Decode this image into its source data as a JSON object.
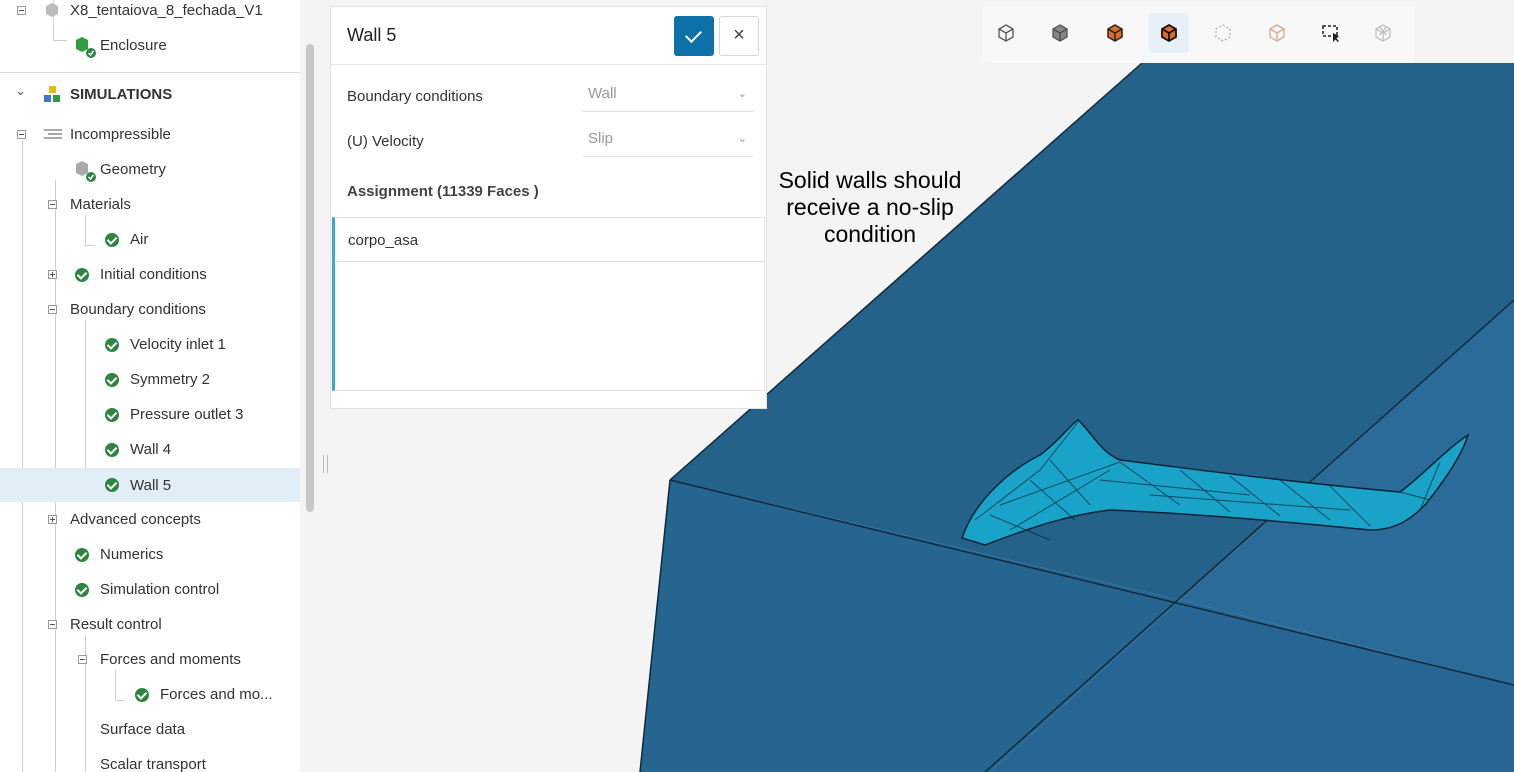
{
  "tree": {
    "top_item": "X8_tentaiova_8_fechada_V1",
    "enclosure": "Enclosure",
    "simulations_header": "SIMULATIONS",
    "incompressible": "Incompressible",
    "geometry": "Geometry",
    "materials": "Materials",
    "air": "Air",
    "initial_conditions": "Initial conditions",
    "boundary_conditions": "Boundary conditions",
    "velocity_inlet": "Velocity inlet 1",
    "symmetry": "Symmetry 2",
    "pressure_outlet": "Pressure outlet 3",
    "wall4": "Wall 4",
    "wall5": "Wall 5",
    "advanced_concepts": "Advanced concepts",
    "numerics": "Numerics",
    "simulation_control": "Simulation control",
    "result_control": "Result control",
    "forces_and_moments": "Forces and moments",
    "forces_and_mo_item": "Forces and mo...",
    "surface_data": "Surface data",
    "scalar_transport": "Scalar transport"
  },
  "dialog": {
    "title": "Wall 5",
    "boundary_conditions_label": "Boundary conditions",
    "boundary_conditions_value": "Wall",
    "velocity_label": "(U) Velocity",
    "velocity_value": "Slip",
    "assignment_title": "Assignment (11339 Faces )",
    "assignment_item": "corpo_asa"
  },
  "annotation": {
    "line1": "Solid walls should",
    "line2": "receive a no-slip",
    "line3": "condition"
  },
  "colors": {
    "domain_face": "#25628a",
    "model_mesh": "#1aa3c8",
    "accent": "#0b71a8",
    "check": "#2e8540"
  }
}
